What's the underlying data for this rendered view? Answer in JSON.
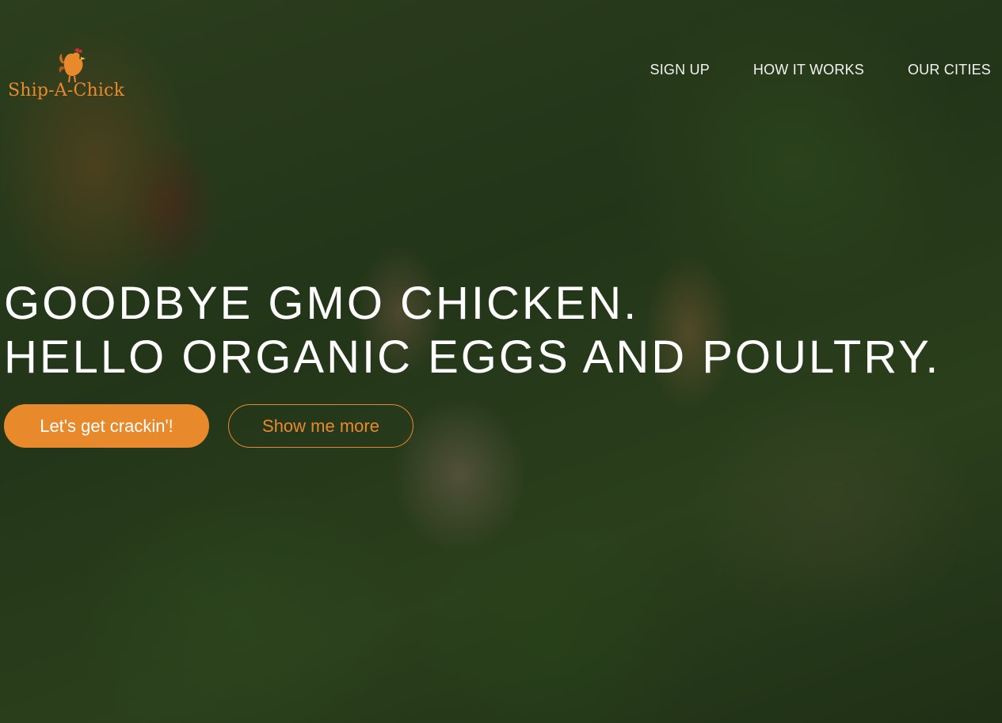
{
  "brand": {
    "name": "Ship-A-Chick",
    "logo_icon": "rooster-icon",
    "accent_color": "#e8892b"
  },
  "nav": {
    "items": [
      {
        "label": "SIGN UP"
      },
      {
        "label": "HOW IT WORKS"
      },
      {
        "label": "OUR CITIES"
      }
    ]
  },
  "hero": {
    "headline_line1": "GOODBYE GMO CHICKEN.",
    "headline_line2": "HELLO ORGANIC EGGS AND POULTRY.",
    "primary_cta": "Let's get crackin'!",
    "secondary_cta": "Show me more"
  }
}
